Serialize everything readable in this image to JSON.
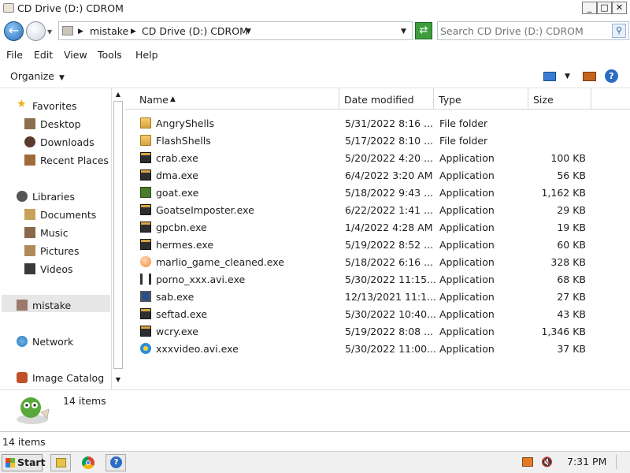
{
  "window": {
    "title": "CD Drive (D:) CDROM"
  },
  "address": {
    "crumbs": [
      "mistake",
      "CD Drive (D:) CDROM"
    ],
    "search_placeholder": "Search CD Drive (D:) CDROM"
  },
  "menu": [
    "File",
    "Edit",
    "View",
    "Tools",
    "Help"
  ],
  "toolbar": {
    "organize_label": "Organize"
  },
  "nav": {
    "favorites": {
      "label": "Favorites",
      "items": [
        "Desktop",
        "Downloads",
        "Recent Places"
      ]
    },
    "libraries": {
      "label": "Libraries",
      "items": [
        "Documents",
        "Music",
        "Pictures",
        "Videos"
      ]
    },
    "user": "mistake",
    "network": "Network",
    "catalog": "Image Catalog"
  },
  "columns": {
    "name": "Name",
    "date": "Date modified",
    "type": "Type",
    "size": "Size"
  },
  "files": [
    {
      "name": "AngryShells",
      "date": "5/31/2022 8:16 ...",
      "type": "File folder",
      "size": "",
      "icon": "folder-icon"
    },
    {
      "name": "FlashShells",
      "date": "5/17/2022 8:10 ...",
      "type": "File folder",
      "size": "",
      "icon": "folder-icon"
    },
    {
      "name": "crab.exe",
      "date": "5/20/2022 4:20 ...",
      "type": "Application",
      "size": "100 KB",
      "icon": "application-icon"
    },
    {
      "name": "dma.exe",
      "date": "6/4/2022 3:20 AM",
      "type": "Application",
      "size": "56 KB",
      "icon": "application-icon"
    },
    {
      "name": "goat.exe",
      "date": "5/18/2022 9:43 ...",
      "type": "Application",
      "size": "1,162 KB",
      "icon": "goat-app-icon"
    },
    {
      "name": "GoatseImposter.exe",
      "date": "6/22/2022 1:41 ...",
      "type": "Application",
      "size": "29 KB",
      "icon": "application-icon"
    },
    {
      "name": "gpcbn.exe",
      "date": "1/4/2022 4:28 AM",
      "type": "Application",
      "size": "19 KB",
      "icon": "application-icon"
    },
    {
      "name": "hermes.exe",
      "date": "5/19/2022 8:52 ...",
      "type": "Application",
      "size": "60 KB",
      "icon": "application-icon"
    },
    {
      "name": "marlio_game_cleaned.exe",
      "date": "5/18/2022 6:16 ...",
      "type": "Application",
      "size": "328 KB",
      "icon": "orange-egg-icon"
    },
    {
      "name": "porno_xxx.avi.exe",
      "date": "5/30/2022 11:15...",
      "type": "Application",
      "size": "68 KB",
      "icon": "figure-icon"
    },
    {
      "name": "sab.exe",
      "date": "12/13/2021 11:1...",
      "type": "Application",
      "size": "27 KB",
      "icon": "computer-icon"
    },
    {
      "name": "seftad.exe",
      "date": "5/30/2022 10:40...",
      "type": "Application",
      "size": "43 KB",
      "icon": "application-icon"
    },
    {
      "name": "wcry.exe",
      "date": "5/19/2022 8:08 ...",
      "type": "Application",
      "size": "1,346 KB",
      "icon": "application-icon"
    },
    {
      "name": "xxxvideo.avi.exe",
      "date": "5/30/2022 11:00...",
      "type": "Application",
      "size": "37 KB",
      "icon": "media-player-icon"
    }
  ],
  "details": {
    "count": "14 items"
  },
  "status": {
    "text": "14 items"
  },
  "taskbar": {
    "start_label": "Start",
    "clock": "7:31 PM"
  },
  "colors": {
    "accent": "#2a6fb8",
    "selection": "#e7e7e7",
    "folder": "#d9a441"
  }
}
